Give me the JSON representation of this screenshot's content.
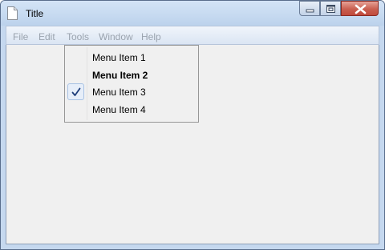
{
  "window": {
    "title": "Title",
    "icon": "document-icon"
  },
  "controls": {
    "minimize": "minimize-icon",
    "maximize": "maximize-icon",
    "close": "close-icon"
  },
  "menubar": {
    "items": [
      "File",
      "Edit",
      "Tools",
      "Window",
      "Help"
    ]
  },
  "dropdown": {
    "items": [
      {
        "label": "Menu Item 1",
        "bold": false,
        "checked": false
      },
      {
        "label": "Menu Item 2",
        "bold": true,
        "checked": false
      },
      {
        "label": "Menu Item 3",
        "bold": false,
        "checked": true
      },
      {
        "label": "Menu Item 4",
        "bold": false,
        "checked": false
      }
    ]
  },
  "colors": {
    "menu_text_disabled": "#9aa3ae",
    "check_color": "#1d3d7a",
    "close_button": "#c95f50"
  }
}
